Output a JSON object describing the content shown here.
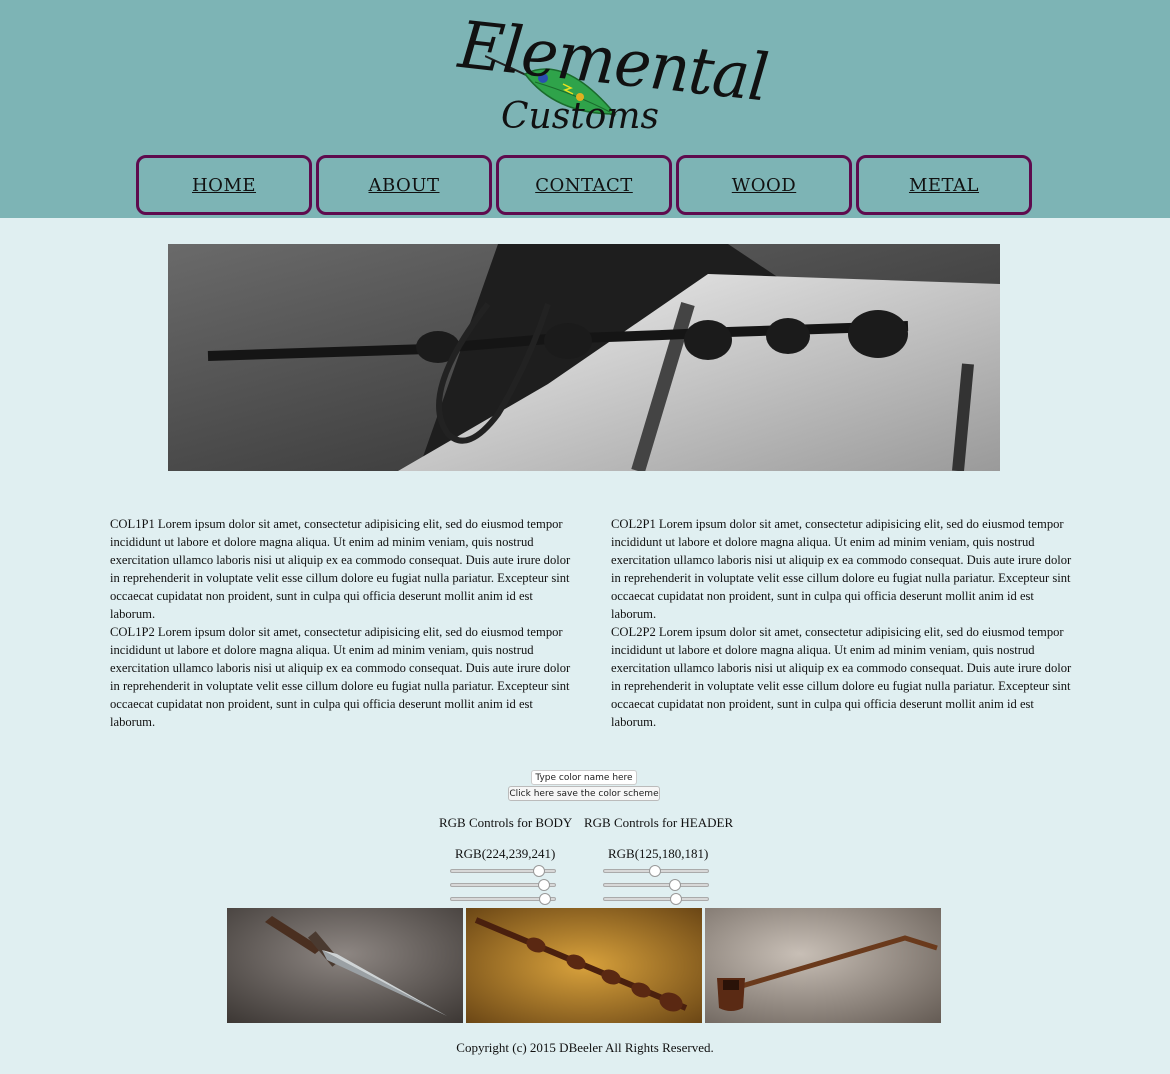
{
  "header": {
    "bg_color": "#7db4b5",
    "logo_line1": "Elemental",
    "logo_line2": "Customs"
  },
  "nav": {
    "border_color": "#5e0b4e",
    "items": [
      {
        "label": "HOME"
      },
      {
        "label": "ABOUT"
      },
      {
        "label": "CONTACT"
      },
      {
        "label": "WOOD"
      },
      {
        "label": "METAL"
      }
    ]
  },
  "hero": {
    "icon": "wand-on-book-photo"
  },
  "columns": {
    "col1": {
      "p1": "COL1P1 Lorem ipsum dolor sit amet, consectetur adipisicing elit, sed do eiusmod tempor incididunt ut labore et dolore magna aliqua. Ut enim ad minim veniam, quis nostrud exercitation ullamco laboris nisi ut aliquip ex ea commodo consequat. Duis aute irure dolor in reprehenderit in voluptate velit esse cillum dolore eu fugiat nulla pariatur. Excepteur sint occaecat cupidatat non proident, sunt in culpa qui officia deserunt mollit anim id est laborum.",
      "p2": "COL1P2 Lorem ipsum dolor sit amet, consectetur adipisicing elit, sed do eiusmod tempor incididunt ut labore et dolore magna aliqua. Ut enim ad minim veniam, quis nostrud exercitation ullamco laboris nisi ut aliquip ex ea commodo consequat. Duis aute irure dolor in reprehenderit in voluptate velit esse cillum dolore eu fugiat nulla pariatur. Excepteur sint occaecat cupidatat non proident, sunt in culpa qui officia deserunt mollit anim id est laborum."
    },
    "col2": {
      "p1": "COL2P1 Lorem ipsum dolor sit amet, consectetur adipisicing elit, sed do eiusmod tempor incididunt ut labore et dolore magna aliqua. Ut enim ad minim veniam, quis nostrud exercitation ullamco laboris nisi ut aliquip ex ea commodo consequat. Duis aute irure dolor in reprehenderit in voluptate velit esse cillum dolore eu fugiat nulla pariatur. Excepteur sint occaecat cupidatat non proident, sunt in culpa qui officia deserunt mollit anim id est laborum.",
      "p2": "COL2P2 Lorem ipsum dolor sit amet, consectetur adipisicing elit, sed do eiusmod tempor incididunt ut labore et dolore magna aliqua. Ut enim ad minim veniam, quis nostrud exercitation ullamco laboris nisi ut aliquip ex ea commodo consequat. Duis aute irure dolor in reprehenderit in voluptate velit esse cillum dolore eu fugiat nulla pariatur. Excepteur sint occaecat cupidatat non proident, sunt in culpa qui officia deserunt mollit anim id est laborum."
    }
  },
  "controls": {
    "color_input_placeholder": "Type color name here",
    "save_button_label": "Click here save the color scheme",
    "body_heading": "RGB Controls for BODY",
    "header_heading": "RGB Controls for HEADER",
    "body_rgb_label": "RGB(224,239,241)",
    "header_rgb_label": "RGB(125,180,181)",
    "body_rgb": [
      224,
      239,
      241
    ],
    "header_rgb": [
      125,
      180,
      181
    ],
    "slider_max": 255
  },
  "gallery": {
    "items": [
      {
        "icon": "knife-photo"
      },
      {
        "icon": "wand-photo"
      },
      {
        "icon": "pipe-photo"
      }
    ]
  },
  "footer": {
    "text": "Copyright (c) 2015 DBeeler All Rights Reserved."
  },
  "page": {
    "bg_color": "#e0eff1"
  }
}
